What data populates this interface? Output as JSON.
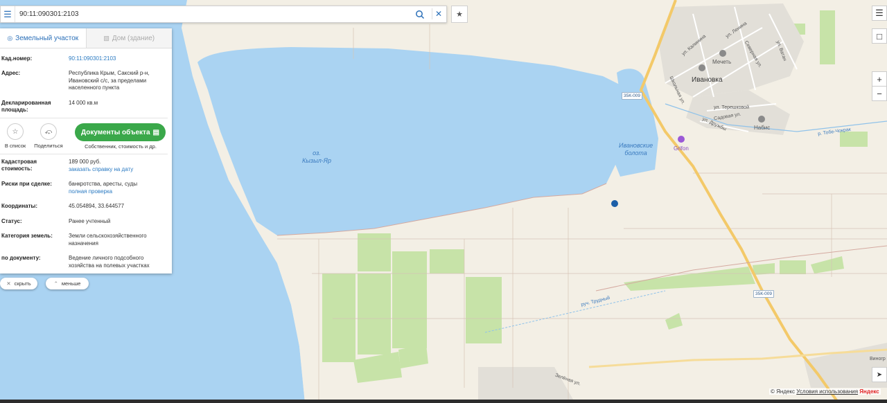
{
  "search": {
    "value": "90:11:090301:2103",
    "menu_icon": "menu-icon",
    "search_icon": "search-icon",
    "clear_icon": "close-icon"
  },
  "favorites_icon": "star-icon",
  "panel": {
    "tabs": [
      {
        "label": "Земельный участок",
        "icon": "land-plot-icon",
        "active": true
      },
      {
        "label": "Дом (здание)",
        "icon": "building-icon",
        "active": false
      }
    ],
    "fields_top": [
      {
        "label": "Кад.номер:",
        "value": "90:11:090301:2103",
        "link": true
      },
      {
        "label": "Адрес:",
        "value": "Республика Крым, Сакский р-н, Ивановский с/с, за пределами населенного пункта"
      },
      {
        "label": "Декларированная площадь:",
        "value": "14 000 кв.м"
      }
    ],
    "actions": {
      "add_to_list": "В список",
      "share": "Поделиться",
      "documents_button": "Документы объекта",
      "documents_sub": "Собственник, стоимость и др."
    },
    "fields_bottom": [
      {
        "label": "Кадастровая стоимость:",
        "value": "189 000 руб.",
        "link_text": "заказать справку на дату"
      },
      {
        "label": "Риски при сделке:",
        "value": "банкротства, аресты, суды",
        "link_text": "полная проверка"
      },
      {
        "label": "Координаты:",
        "value": "45.054894, 33.644577"
      },
      {
        "label": "Статус:",
        "value": "Ранее учтенный"
      },
      {
        "label": "Категория земель:",
        "value": "Земли сельскохозяйственного назначения"
      },
      {
        "label": "по документу:",
        "value": "Ведение личного подсобного хозяйства на полевых участках"
      }
    ],
    "hide_button": "скрыть",
    "less_button": "меньше"
  },
  "map": {
    "lake_label": "оз.\nКызыл-Яр",
    "swamp_label": "Ивановские\nболота",
    "town_label": "Ивановка",
    "poi": {
      "mosque": "Мечеть",
      "nabis": "Набис",
      "grifon": "Grifon"
    },
    "streets": [
      "ул. Калинина",
      "ул. Ленина",
      "Северная ул.",
      "ул. Ватан",
      "Школьная ул.",
      "ул. Терешковой",
      "Садовая ул.",
      "ул. Дружбы",
      "р. Тобе-Чокрак",
      "руч. Трудный",
      "Зелёная ул.",
      "Виногр"
    ],
    "road_badges": [
      "35К-009",
      "35К-009"
    ],
    "colors": {
      "water": "#aad3f2",
      "land": "#f3efe5",
      "field": "#c7e3a8",
      "marker": "#1c5fa8",
      "road": "#f3c969"
    }
  },
  "controls": {
    "layers_icon": "layers-icon",
    "panel_toggle_icon": "sidebar-toggle-icon",
    "zoom_in": "+",
    "zoom_out": "−",
    "locate_icon": "locate-arrow-icon"
  },
  "copyright": {
    "prefix": "© Яндекс",
    "terms": "Условия использования",
    "logo": "Яндекс"
  }
}
